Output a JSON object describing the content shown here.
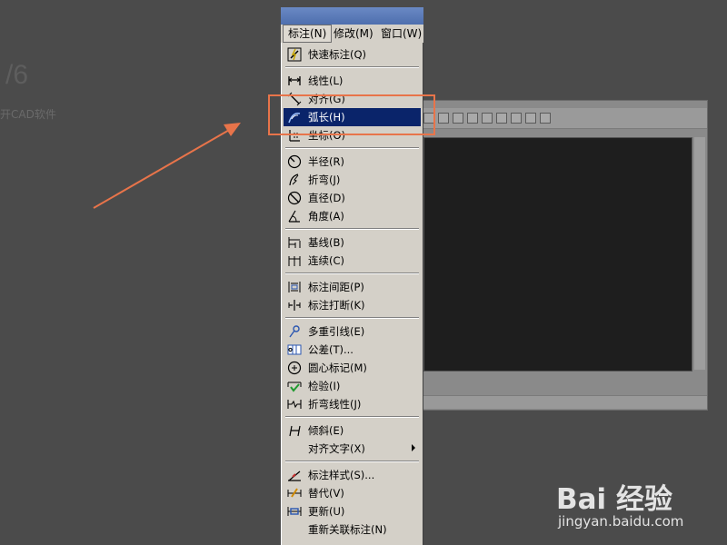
{
  "background": {
    "step_text": "/6",
    "caption": "开CAD软件"
  },
  "menubar": {
    "items": [
      {
        "label": "标注(N)",
        "active": true
      },
      {
        "label": "修改(M)",
        "active": false
      },
      {
        "label": "窗口(W)",
        "active": false
      }
    ]
  },
  "menu": {
    "items": [
      {
        "label": "快速标注(Q)",
        "icon": "quick-dimension-icon"
      },
      {
        "label": "线性(L)",
        "icon": "linear-dimension-icon"
      },
      {
        "label": "对齐(G)",
        "icon": "aligned-dimension-icon"
      },
      {
        "label": "弧长(H)",
        "icon": "arc-length-icon",
        "highlighted": true
      },
      {
        "label": "坐标(O)",
        "icon": "ordinate-dimension-icon"
      },
      {
        "label": "半径(R)",
        "icon": "radius-dimension-icon"
      },
      {
        "label": "折弯(J)",
        "icon": "jogged-dimension-icon"
      },
      {
        "label": "直径(D)",
        "icon": "diameter-dimension-icon"
      },
      {
        "label": "角度(A)",
        "icon": "angular-dimension-icon"
      },
      {
        "label": "基线(B)",
        "icon": "baseline-dimension-icon"
      },
      {
        "label": "连续(C)",
        "icon": "continue-dimension-icon"
      },
      {
        "label": "标注间距(P)",
        "icon": "dimension-space-icon"
      },
      {
        "label": "标注打断(K)",
        "icon": "dimension-break-icon"
      },
      {
        "label": "多重引线(E)",
        "icon": "multileader-icon"
      },
      {
        "label": "公差(T)...",
        "icon": "tolerance-icon"
      },
      {
        "label": "圆心标记(M)",
        "icon": "center-mark-icon"
      },
      {
        "label": "检验(I)",
        "icon": "inspection-icon"
      },
      {
        "label": "折弯线性(J)",
        "icon": "jogged-linear-icon"
      },
      {
        "label": "倾斜(E)",
        "icon": "oblique-icon"
      },
      {
        "label": "对齐文字(X)",
        "icon": "",
        "submenu": true
      },
      {
        "label": "标注样式(S)...",
        "icon": "dimension-style-icon"
      },
      {
        "label": "替代(V)",
        "icon": "override-icon"
      },
      {
        "label": "更新(U)",
        "icon": "update-icon"
      },
      {
        "label": "重新关联标注(N)",
        "icon": ""
      }
    ]
  },
  "watermark": {
    "logo_text": "Bai 经验",
    "url": "jingyan.baidu.com"
  },
  "colors": {
    "highlight_box": "#e8744a",
    "menu_highlight": "#0a246a",
    "menu_bg": "#d4d0c8"
  }
}
